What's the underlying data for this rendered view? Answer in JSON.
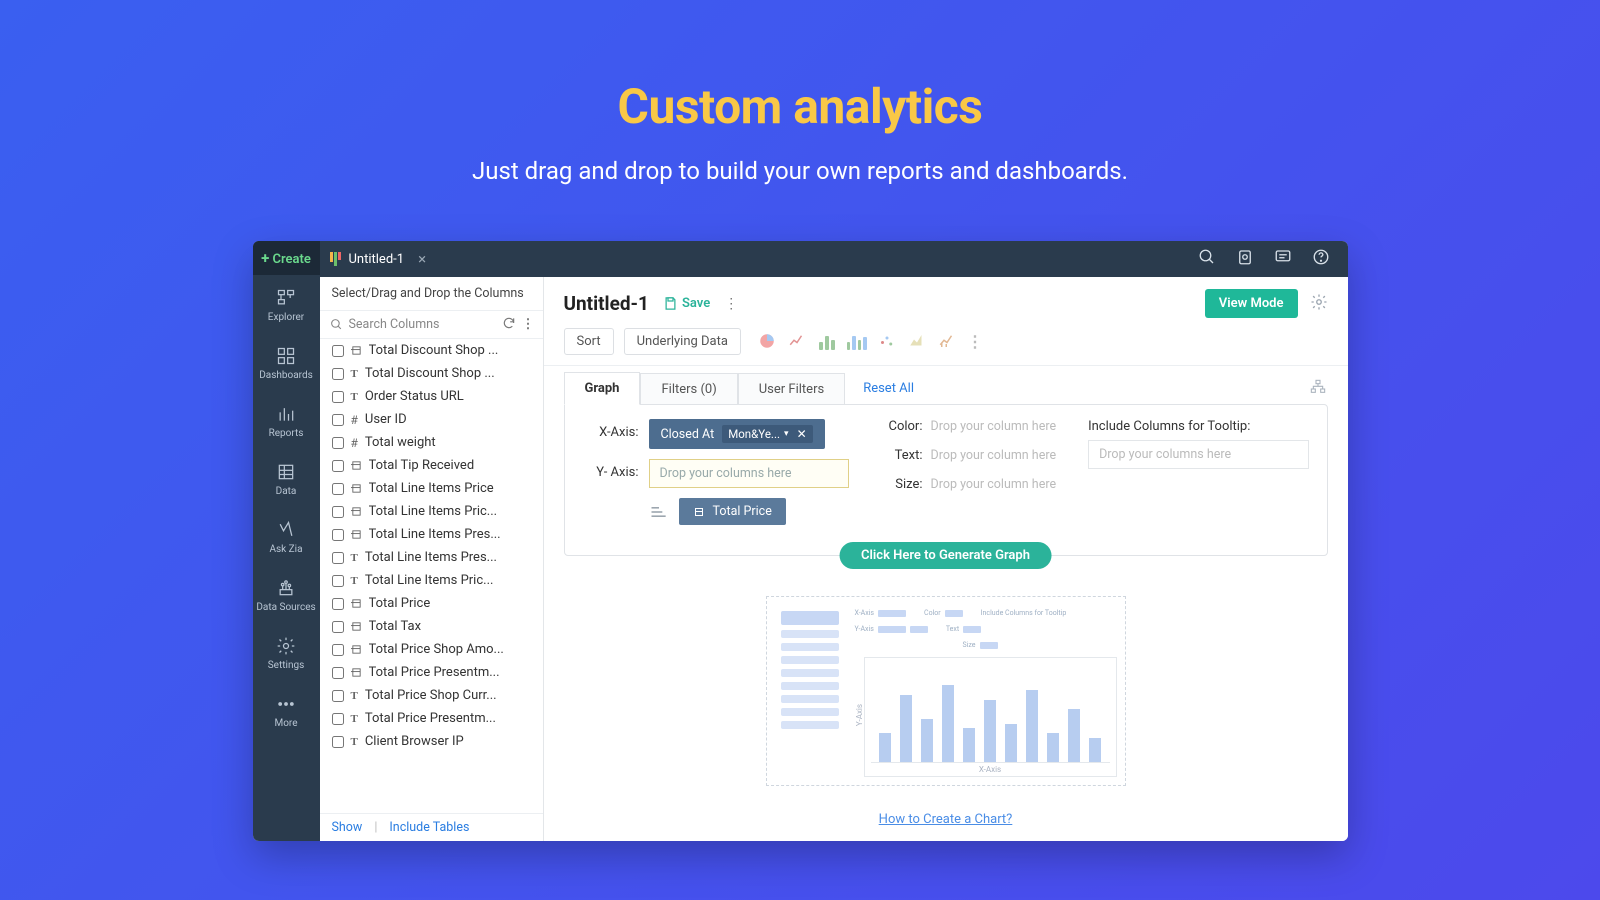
{
  "hero": {
    "title": "Custom analytics",
    "subtitle": "Just drag and drop to build your own reports and dashboards."
  },
  "tab": {
    "title": "Untitled-1"
  },
  "nav": {
    "create": "Create",
    "items": [
      {
        "label": "Explorer"
      },
      {
        "label": "Dashboards"
      },
      {
        "label": "Reports"
      },
      {
        "label": "Data"
      },
      {
        "label": "Ask Zia"
      },
      {
        "label": "Data Sources"
      },
      {
        "label": "Settings"
      },
      {
        "label": "More"
      }
    ]
  },
  "columnsPanel": {
    "header": "Select/Drag and Drop the Columns",
    "search_placeholder": "Search Columns",
    "cols": [
      {
        "type": "cur",
        "label": "Total Discount Shop ..."
      },
      {
        "type": "txt",
        "label": "Total Discount Shop ..."
      },
      {
        "type": "txt",
        "label": "Order Status URL"
      },
      {
        "type": "num",
        "label": "User ID"
      },
      {
        "type": "num",
        "label": "Total weight"
      },
      {
        "type": "cur",
        "label": "Total Tip Received"
      },
      {
        "type": "cur",
        "label": "Total Line Items Price"
      },
      {
        "type": "cur",
        "label": "Total Line Items Pric..."
      },
      {
        "type": "cur",
        "label": "Total Line Items Pres..."
      },
      {
        "type": "txt",
        "label": "Total Line Items Pres..."
      },
      {
        "type": "txt",
        "label": "Total Line Items Pric..."
      },
      {
        "type": "cur",
        "label": "Total Price"
      },
      {
        "type": "cur",
        "label": "Total Tax"
      },
      {
        "type": "cur",
        "label": "Total Price Shop Amo..."
      },
      {
        "type": "cur",
        "label": "Total Price Presentm..."
      },
      {
        "type": "txt",
        "label": "Total Price Shop Curr..."
      },
      {
        "type": "txt",
        "label": "Total Price Presentm..."
      },
      {
        "type": "txt",
        "label": "Client Browser IP"
      }
    ],
    "footer": {
      "show": "Show",
      "include": "Include Tables"
    }
  },
  "main": {
    "doc_title": "Untitled-1",
    "save": "Save",
    "view_mode": "View Mode",
    "sort": "Sort",
    "underlying": "Underlying Data",
    "tabs": {
      "graph": "Graph",
      "filters": "Filters  (0)",
      "user_filters": "User Filters"
    },
    "reset": "Reset All",
    "xaxis": {
      "label": "X-Axis:",
      "chip": "Closed At",
      "fmt": "Mon&Ye..."
    },
    "yaxis": {
      "label": "Y- Axis:",
      "placeholder": "Drop your columns here",
      "chip": "Total Price"
    },
    "color": {
      "label": "Color:",
      "placeholder": "Drop your column here"
    },
    "text": {
      "label": "Text:",
      "placeholder": "Drop your column here"
    },
    "size": {
      "label": "Size:",
      "placeholder": "Drop your column here"
    },
    "tooltip": {
      "label": "Include Columns for Tooltip:",
      "placeholder": "Drop your columns here"
    },
    "generate": "Click Here to Generate Graph",
    "preview": {
      "xaxis": "X-Axis",
      "yaxis": "Y-Axis",
      "hints": [
        "X-Axis",
        "Color",
        "Include Columns for Tooltip",
        "Y-Axis",
        "Text",
        "Size"
      ]
    },
    "howto": "How to Create a Chart?"
  }
}
